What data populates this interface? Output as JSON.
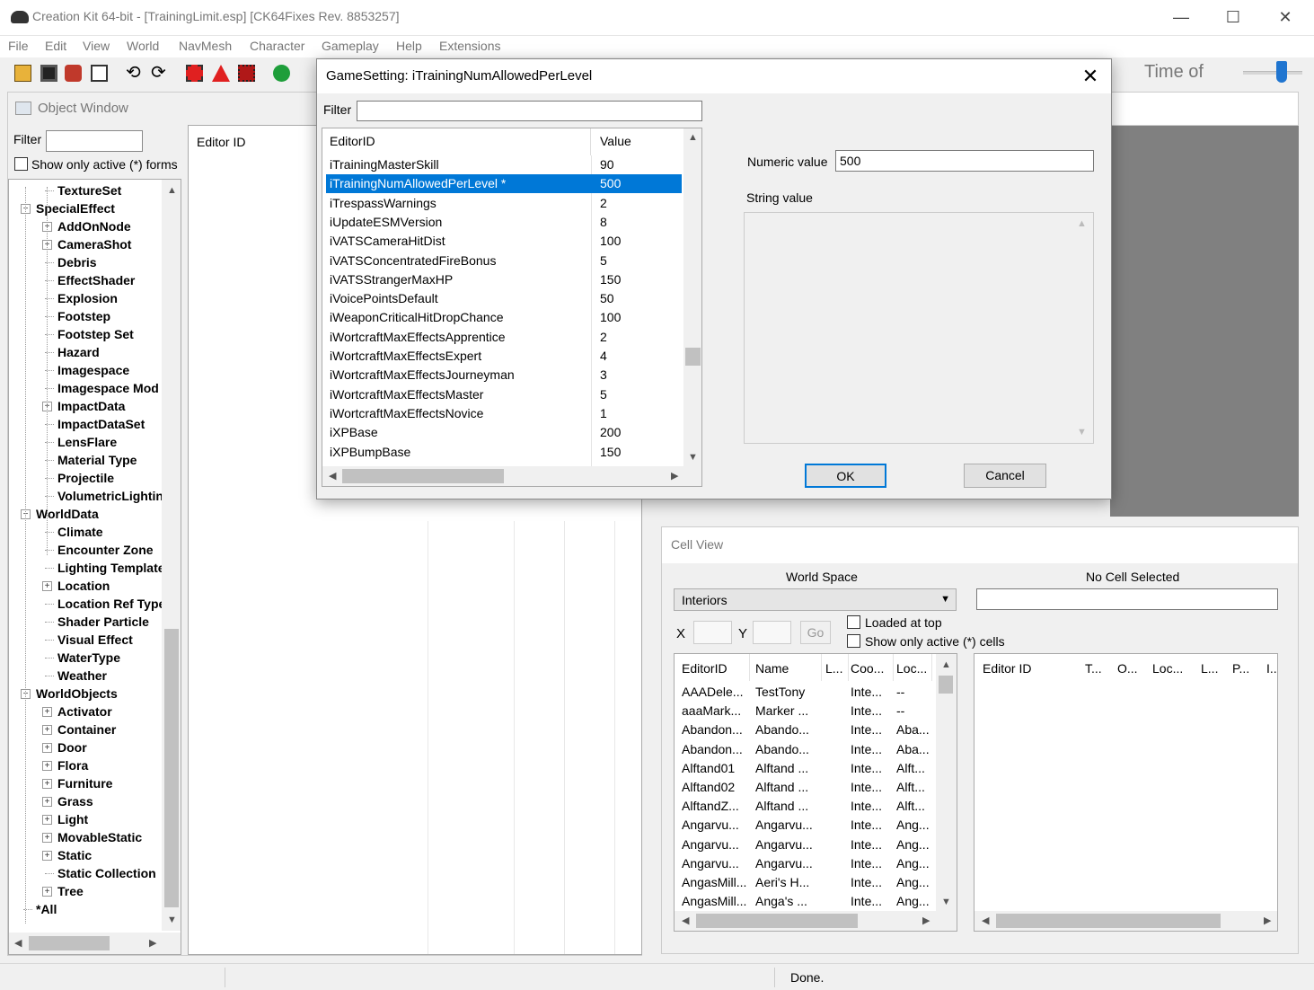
{
  "window": {
    "title": "Creation Kit 64-bit - [TrainingLimit.esp] [CK64Fixes Rev. 8853257]",
    "minimize": "—",
    "maximize": "☐",
    "close": "✕"
  },
  "menu": [
    "File",
    "Edit",
    "View",
    "World",
    "NavMesh",
    "Character",
    "Gameplay",
    "Help",
    "Extensions"
  ],
  "toolbar": {
    "time_label": "Time of",
    "icons": [
      "open-icon",
      "save-icon",
      "plugins-icon",
      "preferences-icon",
      "undo-icon",
      "redo-icon",
      "render-window-icon",
      "warnings-icon",
      "animation-icon",
      "world-icon"
    ]
  },
  "object_window": {
    "title": "Object Window",
    "filter_label": "Filter",
    "filter_value": "",
    "show_active_label": "Show only active (*) forms",
    "editor_id_header": "Editor ID",
    "tree": [
      {
        "label": "TextureSet",
        "level": 1,
        "exp": ""
      },
      {
        "label": "SpecialEffect",
        "level": 0,
        "exp": "-"
      },
      {
        "label": "AddOnNode",
        "level": 1,
        "exp": "+"
      },
      {
        "label": "CameraShot",
        "level": 1,
        "exp": "+"
      },
      {
        "label": "Debris",
        "level": 1,
        "exp": ""
      },
      {
        "label": "EffectShader",
        "level": 1,
        "exp": ""
      },
      {
        "label": "Explosion",
        "level": 1,
        "exp": ""
      },
      {
        "label": "Footstep",
        "level": 1,
        "exp": ""
      },
      {
        "label": "Footstep Set",
        "level": 1,
        "exp": ""
      },
      {
        "label": "Hazard",
        "level": 1,
        "exp": ""
      },
      {
        "label": "Imagespace",
        "level": 1,
        "exp": ""
      },
      {
        "label": "Imagespace Mod",
        "level": 1,
        "exp": ""
      },
      {
        "label": "ImpactData",
        "level": 1,
        "exp": "+"
      },
      {
        "label": "ImpactDataSet",
        "level": 1,
        "exp": ""
      },
      {
        "label": "LensFlare",
        "level": 1,
        "exp": ""
      },
      {
        "label": "Material Type",
        "level": 1,
        "exp": ""
      },
      {
        "label": "Projectile",
        "level": 1,
        "exp": ""
      },
      {
        "label": "VolumetricLighting",
        "level": 1,
        "exp": ""
      },
      {
        "label": "WorldData",
        "level": 0,
        "exp": "-"
      },
      {
        "label": "Climate",
        "level": 1,
        "exp": ""
      },
      {
        "label": "Encounter Zone",
        "level": 1,
        "exp": ""
      },
      {
        "label": "Lighting Template",
        "level": 1,
        "exp": ""
      },
      {
        "label": "Location",
        "level": 1,
        "exp": "+"
      },
      {
        "label": "Location Ref Type",
        "level": 1,
        "exp": ""
      },
      {
        "label": "Shader Particle",
        "level": 1,
        "exp": ""
      },
      {
        "label": "Visual Effect",
        "level": 1,
        "exp": ""
      },
      {
        "label": "WaterType",
        "level": 1,
        "exp": ""
      },
      {
        "label": "Weather",
        "level": 1,
        "exp": ""
      },
      {
        "label": "WorldObjects",
        "level": 0,
        "exp": "-"
      },
      {
        "label": "Activator",
        "level": 1,
        "exp": "+"
      },
      {
        "label": "Container",
        "level": 1,
        "exp": "+"
      },
      {
        "label": "Door",
        "level": 1,
        "exp": "+"
      },
      {
        "label": "Flora",
        "level": 1,
        "exp": "+"
      },
      {
        "label": "Furniture",
        "level": 1,
        "exp": "+"
      },
      {
        "label": "Grass",
        "level": 1,
        "exp": "+"
      },
      {
        "label": "Light",
        "level": 1,
        "exp": "+"
      },
      {
        "label": "MovableStatic",
        "level": 1,
        "exp": "+"
      },
      {
        "label": "Static",
        "level": 1,
        "exp": "+"
      },
      {
        "label": "Static Collection",
        "level": 1,
        "exp": ""
      },
      {
        "label": "Tree",
        "level": 1,
        "exp": "+"
      },
      {
        "label": "*All",
        "level": 0,
        "exp": ""
      }
    ]
  },
  "dialog": {
    "title": "GameSetting: iTrainingNumAllowedPerLevel",
    "close": "✕",
    "filter_label": "Filter",
    "filter_value": "",
    "columns": [
      "EditorID",
      "Value"
    ],
    "rows": [
      [
        "iTrainingMasterSkill",
        "90"
      ],
      [
        "iTrainingNumAllowedPerLevel *",
        "500"
      ],
      [
        "iTrespassWarnings",
        "2"
      ],
      [
        "iUpdateESMVersion",
        "8"
      ],
      [
        "iVATSCameraHitDist",
        "100"
      ],
      [
        "iVATSConcentratedFireBonus",
        "5"
      ],
      [
        "iVATSStrangerMaxHP",
        "150"
      ],
      [
        "iVoicePointsDefault",
        "50"
      ],
      [
        "iWeaponCriticalHitDropChance",
        "100"
      ],
      [
        "iWortcraftMaxEffectsApprentice",
        "2"
      ],
      [
        "iWortcraftMaxEffectsExpert",
        "4"
      ],
      [
        "iWortcraftMaxEffectsJourneyman",
        "3"
      ],
      [
        "iWortcraftMaxEffectsMaster",
        "5"
      ],
      [
        "iWortcraftMaxEffectsNovice",
        "1"
      ],
      [
        "iXPBase",
        "200"
      ],
      [
        "iXPBumpBase",
        "150"
      ]
    ],
    "selected_row": 1,
    "numeric_label": "Numeric value",
    "numeric_value": "500",
    "string_label": "String value",
    "string_value": "",
    "ok": "OK",
    "cancel": "Cancel"
  },
  "cell_view": {
    "title": "Cell View",
    "world_space_label": "World Space",
    "no_cell_label": "No Cell Selected",
    "world_space_value": "Interiors",
    "x_label": "X",
    "y_label": "Y",
    "x_value": "",
    "y_value": "",
    "go": "Go",
    "loaded_top": "Loaded at top",
    "show_active": "Show only active (*) cells",
    "left_columns": [
      "EditorID",
      "Name",
      "L...",
      "Coo...",
      "Loc..."
    ],
    "left_rows": [
      [
        "AAADele...",
        "TestTony",
        "",
        "Inte...",
        "--"
      ],
      [
        "aaaMark...",
        "Marker ...",
        "",
        "Inte...",
        "--"
      ],
      [
        "Abandon...",
        "Abando...",
        "",
        "Inte...",
        "Aba..."
      ],
      [
        "Abandon...",
        "Abando...",
        "",
        "Inte...",
        "Aba..."
      ],
      [
        "Alftand01",
        "Alftand ...",
        "",
        "Inte...",
        "Alft..."
      ],
      [
        "Alftand02",
        "Alftand ...",
        "",
        "Inte...",
        "Alft..."
      ],
      [
        "AlftandZ...",
        "Alftand ...",
        "",
        "Inte...",
        "Alft..."
      ],
      [
        "Angarvu...",
        "Angarvu...",
        "",
        "Inte...",
        "Ang..."
      ],
      [
        "Angarvu...",
        "Angarvu...",
        "",
        "Inte...",
        "Ang..."
      ],
      [
        "Angarvu...",
        "Angarvu...",
        "",
        "Inte...",
        "Ang..."
      ],
      [
        "AngasMill...",
        "Aeri's H...",
        "",
        "Inte...",
        "Ang..."
      ],
      [
        "AngasMill...",
        "Anga's ...",
        "",
        "Inte...",
        "Ang..."
      ]
    ],
    "right_columns": [
      "Editor ID",
      "T...",
      "O...",
      "Loc...",
      "L...",
      "P...",
      "I..."
    ]
  },
  "status": {
    "text": "Done."
  }
}
